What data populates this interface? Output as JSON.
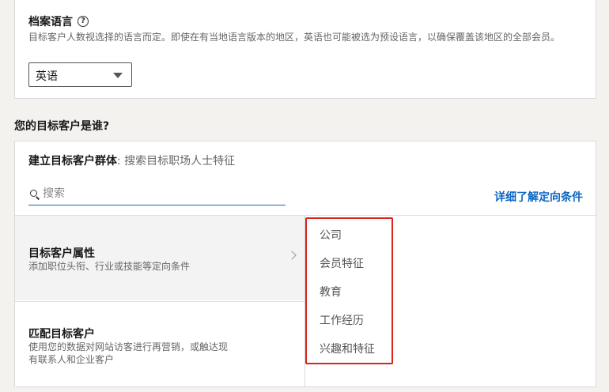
{
  "language_card": {
    "title": "档案语言",
    "help_icon": "question-circle-icon",
    "description": "目标客户人数视选择的语言而定。即使在有当地语言版本的地区，英语也可能被选为预设语言，以确保覆盖该地区的全部会员。",
    "selected_language": "英语"
  },
  "question": "您的目标客户是谁?",
  "audience": {
    "header_bold": "建立目标客户群体",
    "header_rest": ": 搜索目标职场人士特征",
    "search_placeholder": "搜索",
    "learn_more": "详细了解定向条件",
    "attributes": [
      {
        "title": "目标客户属性",
        "description": "添加职位头衔、行业或技能等定向条件"
      },
      {
        "title": "匹配目标客户",
        "description": "使用您的数据对网站访客进行再营销，或触达现有联系人和企业客户"
      }
    ],
    "categories": [
      "公司",
      "会员特征",
      "教育",
      "工作经历",
      "兴趣和特征"
    ]
  },
  "colors": {
    "accent": "#0a66c2",
    "highlight_border": "#d9251b"
  }
}
